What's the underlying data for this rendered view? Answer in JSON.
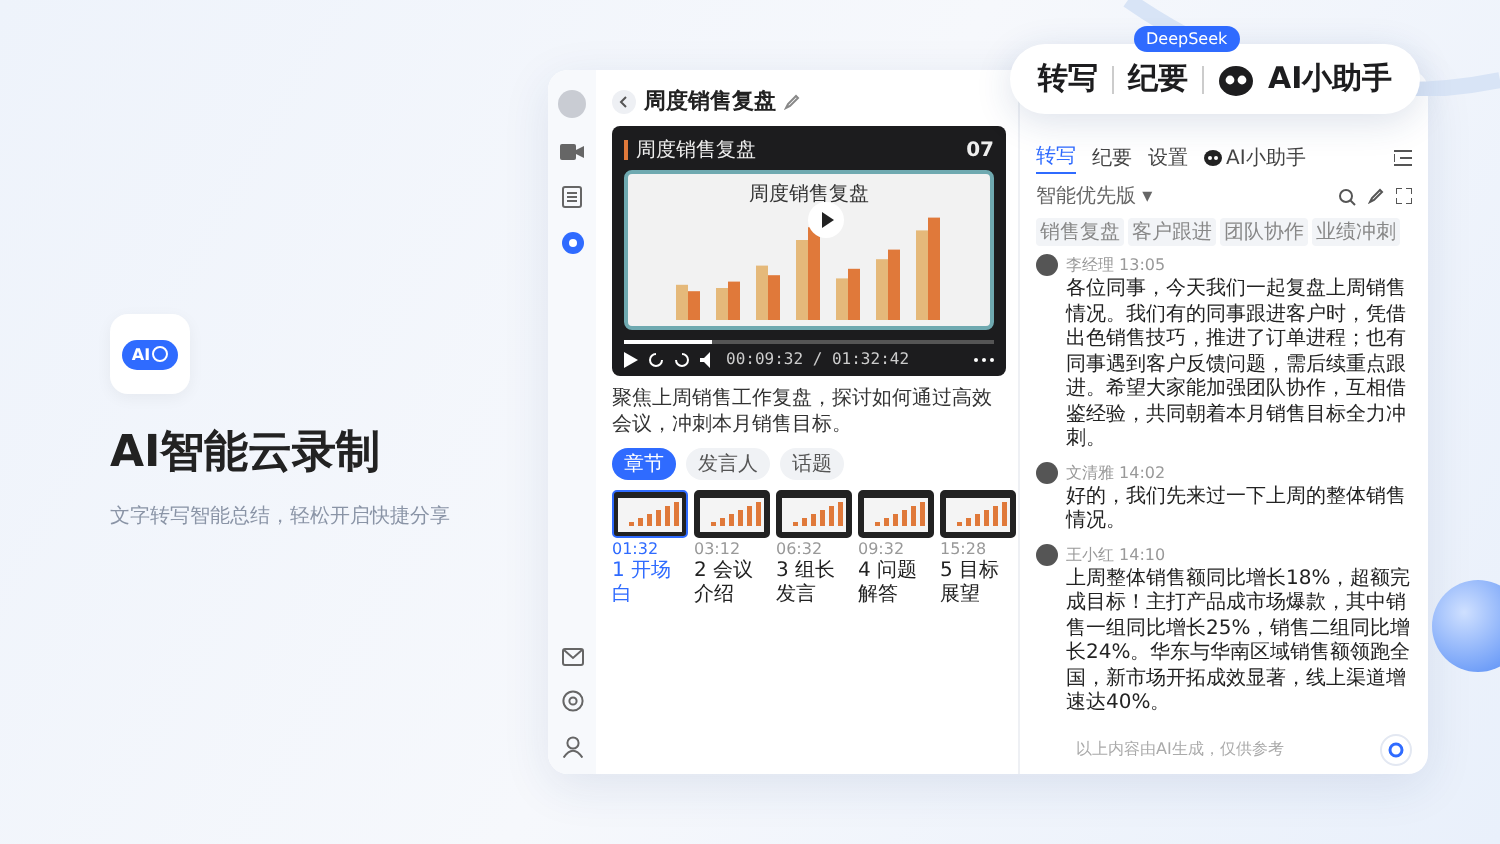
{
  "hero": {
    "app_icon_text": "AI",
    "title": "AI智能云录制",
    "subtitle": "文字转写智能总结，轻松开启快捷分享"
  },
  "callout": {
    "badge": "DeepSeek",
    "items": [
      {
        "kind": "text",
        "label": "转写"
      },
      {
        "kind": "text",
        "label": "纪要"
      },
      {
        "kind": "assistant",
        "label": "AI小助手"
      }
    ]
  },
  "window": {
    "title": "周度销售复盘",
    "sidebar": {
      "top": [
        {
          "kind": "video",
          "active": false
        },
        {
          "kind": "doc",
          "active": false
        },
        {
          "kind": "dot",
          "active": true
        }
      ],
      "bottom": [
        {
          "kind": "mail"
        },
        {
          "kind": "settings"
        },
        {
          "kind": "user"
        }
      ]
    },
    "video": {
      "slide_title": "周度销售复盘",
      "page": "07",
      "chart_title": "周度销售复盘",
      "time": "00:09:32 / 01:32:42",
      "level": 0.24
    },
    "summary": "聚焦上周销售工作复盘，探讨如何通过高效会议，冲刺本月销售目标。",
    "tabs": [
      {
        "label": "章节",
        "selected": true
      },
      {
        "label": "发言人",
        "selected": false
      },
      {
        "label": "话题",
        "selected": false
      }
    ],
    "chapters": [
      {
        "time": "01:32",
        "label": "1 开场白",
        "selected": true
      },
      {
        "time": "03:12",
        "label": "2 会议介绍",
        "selected": false
      },
      {
        "time": "06:32",
        "label": "3 组长发言",
        "selected": false
      },
      {
        "time": "09:32",
        "label": "4 问题解答",
        "selected": false
      },
      {
        "time": "15:28",
        "label": "5 目标展望",
        "selected": false
      }
    ],
    "panel": {
      "tabs": [
        {
          "label": "转写",
          "selected": true,
          "kind": "text"
        },
        {
          "label": "纪要",
          "selected": false,
          "kind": "text"
        },
        {
          "label": "设置",
          "selected": false,
          "kind": "text"
        },
        {
          "label": "AI小助手",
          "selected": false,
          "kind": "assistant"
        }
      ],
      "version": "智能优先版 ▾",
      "chips": [
        "销售复盘",
        "客户跟进",
        "团队协作",
        "业绩冲刺"
      ],
      "messages": [
        {
          "name": "李经理",
          "time": "13:05",
          "text": "各位同事，今天我们一起复盘上周销售情况。我们有的同事跟进客户时，凭借出色销售技巧，推进了订单进程；也有同事遇到客户反馈问题，需后续重点跟进。希望大家能加强团队协作，互相借鉴经验，共同朝着本月销售目标全力冲刺。"
        },
        {
          "name": "文清雅",
          "time": "14:02",
          "text": "好的，我们先来过一下上周的整体销售情况。"
        },
        {
          "name": "王小红",
          "time": "14:10",
          "text": "上周整体销售额同比增长18%，超额完成目标！主打产品成市场爆款，其中销售一组同比增长25%，销售二组同比增长24%。华东与华南区域销售额领跑全国，新市场开拓成效显著，线上渠道增速达40%。"
        }
      ],
      "footer": "以上内容由AI生成，仅供参考"
    }
  }
}
